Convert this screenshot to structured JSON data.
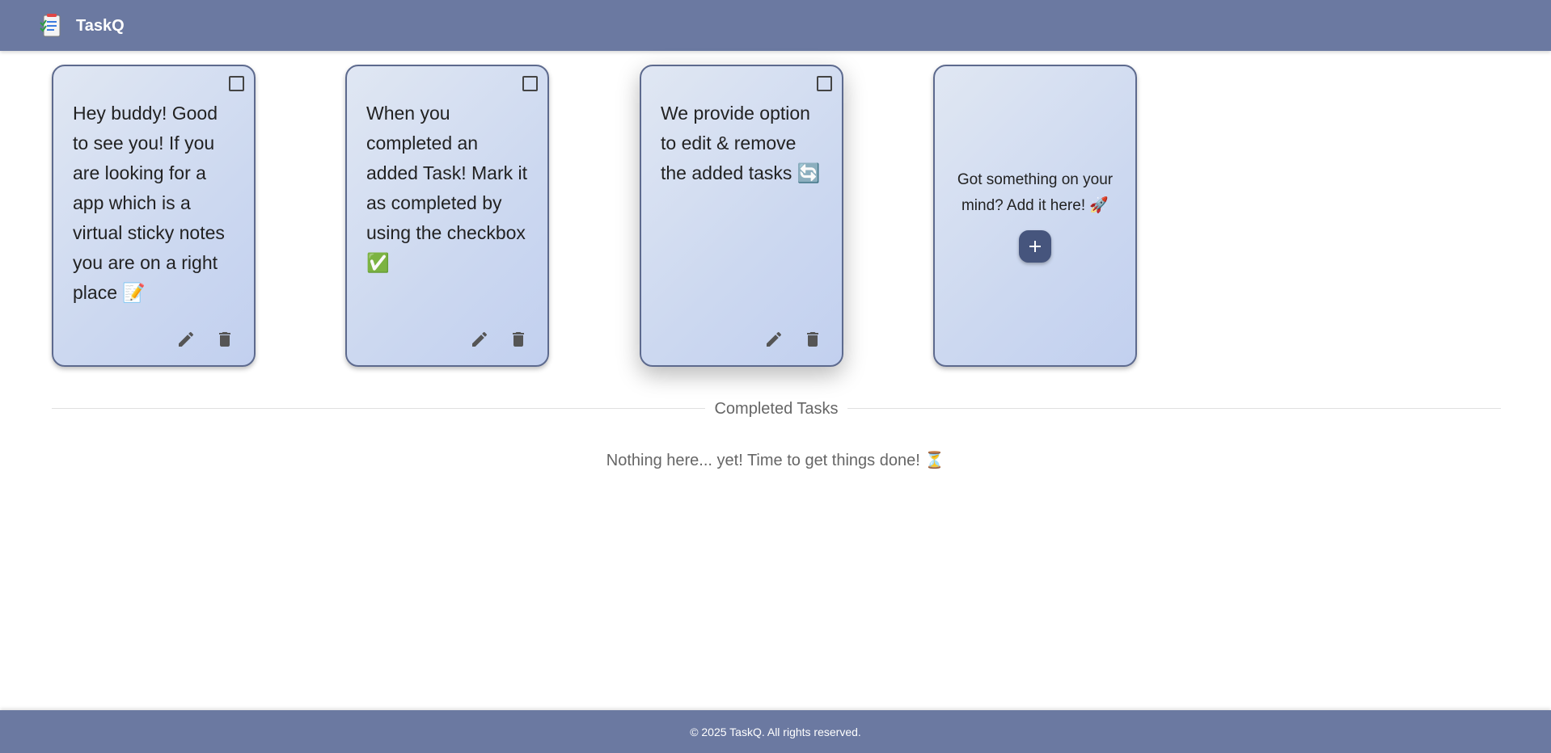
{
  "header": {
    "app_title": "TaskQ",
    "logo_icon": "notepad-checklist-icon"
  },
  "tasks": [
    {
      "text": "Hey buddy! Good to see you! If you are looking for a app which is a virtual sticky notes you are on a right place 📝",
      "completed": false
    },
    {
      "text": "When you completed an added Task! Mark it as completed by using the checkbox ✅",
      "completed": false
    },
    {
      "text": "We provide option to edit & remove the added tasks 🔄",
      "completed": false
    }
  ],
  "add_card": {
    "prompt": "Got something on your mind? Add it here! 🚀",
    "button_label": "+"
  },
  "completed_section": {
    "title": "Completed Tasks",
    "empty_message": "Nothing here... yet! Time to get things done! ⏳"
  },
  "footer": {
    "text": "© 2025 TaskQ. All rights reserved."
  },
  "colors": {
    "header_bg": "#6b79a1",
    "card_border": "#5d6a8e",
    "add_button_bg": "#46557d"
  }
}
